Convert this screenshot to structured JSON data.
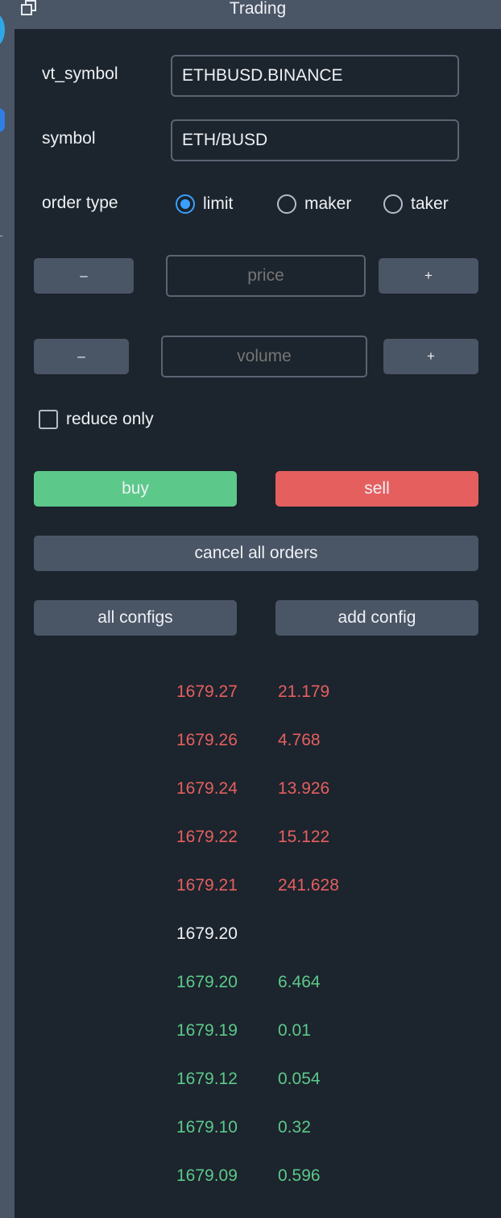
{
  "window": {
    "title": "Trading",
    "float_icon": "float-window-icon"
  },
  "form": {
    "vt_symbol_label": "vt_symbol",
    "vt_symbol_value": "ETHBUSD.BINANCE",
    "symbol_label": "symbol",
    "symbol_value": "ETH/BUSD",
    "order_type_label": "order type",
    "order_types": [
      {
        "label": "limit",
        "checked": true
      },
      {
        "label": "maker",
        "checked": false
      },
      {
        "label": "taker",
        "checked": false
      }
    ],
    "price_minus": "–",
    "price_placeholder": "price",
    "price_plus": "+",
    "volume_minus": "–",
    "volume_placeholder": "volume",
    "volume_plus": "+",
    "reduce_only_label": "reduce only",
    "reduce_only_checked": false
  },
  "actions": {
    "buy": "buy",
    "sell": "sell",
    "cancel_all": "cancel all orders",
    "all_configs": "all configs",
    "add_config": "add config"
  },
  "colors": {
    "buy": "#5cc98a",
    "sell": "#e55f5f",
    "accent": "#3aa0ff",
    "panel": "#1c242d",
    "button": "#4a5566"
  },
  "order_book": {
    "asks": [
      {
        "price": "1679.27",
        "volume": "21.179"
      },
      {
        "price": "1679.26",
        "volume": "4.768"
      },
      {
        "price": "1679.24",
        "volume": "13.926"
      },
      {
        "price": "1679.22",
        "volume": "15.122"
      },
      {
        "price": "1679.21",
        "volume": "241.628"
      }
    ],
    "last_price": "1679.20",
    "bids": [
      {
        "price": "1679.20",
        "volume": "6.464"
      },
      {
        "price": "1679.19",
        "volume": "0.01"
      },
      {
        "price": "1679.12",
        "volume": "0.054"
      },
      {
        "price": "1679.10",
        "volume": "0.32"
      },
      {
        "price": "1679.09",
        "volume": "0.596"
      }
    ]
  }
}
